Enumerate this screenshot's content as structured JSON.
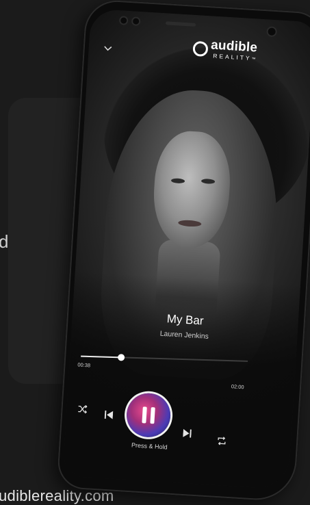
{
  "background": {
    "partial_word": "d",
    "url_text": "udiblereality.com"
  },
  "app": {
    "logo_word": "audible",
    "logo_sub": "REALITY",
    "logo_tm": "™"
  },
  "player": {
    "title": "My Bar",
    "artist": "Lauren Jenkins",
    "current_time": "00:38",
    "total_time": "02:00",
    "progress_fraction": 0.24,
    "hold_label": "Press & Hold"
  },
  "icons": {
    "collapse": "chevron-down-icon",
    "shuffle": "shuffle-icon",
    "previous": "skip-previous-icon",
    "pause": "pause-icon",
    "next": "skip-next-icon",
    "repeat": "repeat-icon"
  },
  "colors": {
    "background": "#1b1b1b",
    "play_gradient_pink": "#e84a8c",
    "play_gradient_purple": "#4b3bb5"
  }
}
